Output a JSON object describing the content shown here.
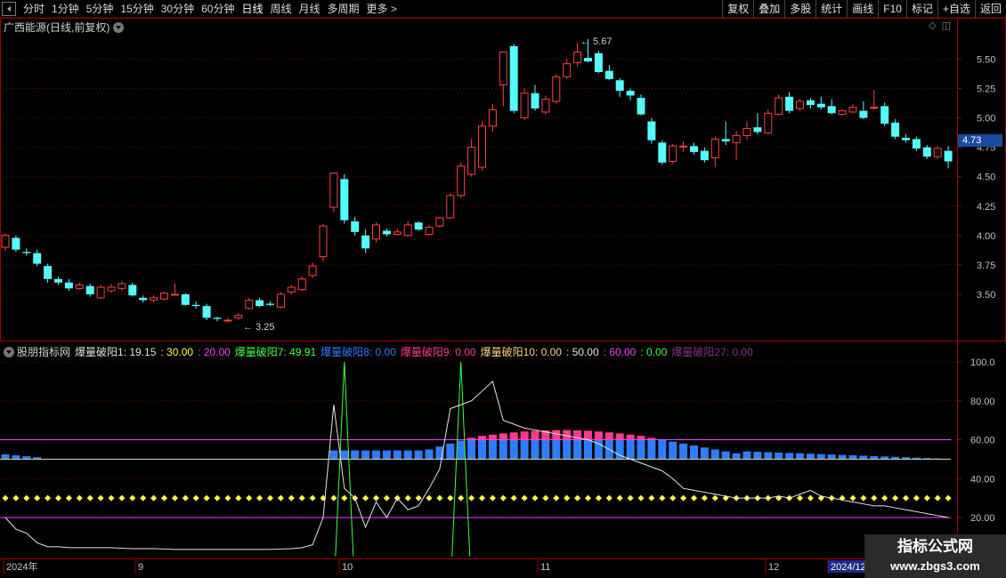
{
  "toolbar": {
    "periods": [
      "分时",
      "1分钟",
      "5分钟",
      "15分钟",
      "30分钟",
      "60分钟",
      "日线",
      "周线",
      "月线",
      "多周期",
      "更多 >"
    ],
    "active_period": "日线",
    "buttons": [
      "复权",
      "叠加",
      "多股",
      "统计",
      "画线",
      "F10",
      "标记",
      "+自选",
      "返回"
    ]
  },
  "main_chart": {
    "title": "广西能源(日线,前复权)",
    "price_axis": [
      "5.50",
      "5.25",
      "5.00",
      "4.75",
      "4.50",
      "4.25",
      "4.00",
      "3.75",
      "3.50"
    ],
    "current_price": "4.73",
    "high_label": "5.67",
    "low_label": "3.25",
    "colors": {
      "up": "#ff4040",
      "down": "#54fcfc",
      "grid": "#7a0000",
      "border": "#a00000"
    }
  },
  "indicator": {
    "name": "股朋指标网",
    "fields": [
      {
        "text": "爆量破阳1: 19.15",
        "color": "#e0e0e0"
      },
      {
        "text": ": 30.00",
        "color": "#ffff40"
      },
      {
        "text": ": 20.00",
        "color": "#ff40ff"
      },
      {
        "text": "爆量破阳7: 49.91",
        "color": "#40ff40"
      },
      {
        "text": "爆量破阳8: 0.00",
        "color": "#2f7dff"
      },
      {
        "text": "爆量破阳9: 0.00",
        "color": "#ff3a8c"
      },
      {
        "text": "爆量破阳10: 0.00",
        "color": "#ffd27a"
      },
      {
        "text": ": 50.00",
        "color": "#e0e0e0"
      },
      {
        "text": ": 60.00",
        "color": "#ff40ff"
      },
      {
        "text": ": 0.00",
        "color": "#40ff40"
      },
      {
        "text": "爆量破阳27: 0.00",
        "color": "#8a2f8a"
      }
    ],
    "axis": [
      "100.0",
      "80.00",
      "60.00",
      "40.00",
      "20.00"
    ]
  },
  "date_axis": [
    "2024年",
    "9",
    "10",
    "11",
    "12",
    "2024/12"
  ],
  "watermark": {
    "line1": "指标公式网",
    "line2": "www.zbgs3.com"
  }
}
